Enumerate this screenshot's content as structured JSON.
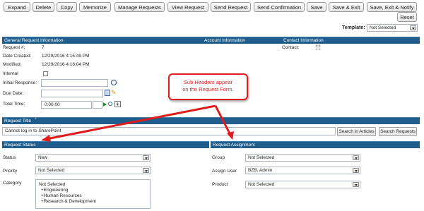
{
  "toolbar": {
    "buttons": [
      "Expand",
      "Delete",
      "Copy",
      "Memorize",
      "Manage Requests",
      "View Request",
      "Send Request",
      "Send Confirmation",
      "Save",
      "Save & Exit",
      "Save, Exit & Notify",
      "Reset"
    ]
  },
  "template": {
    "label": "Template:",
    "value": "Not Selected"
  },
  "general_header": {
    "general": "General Request Information",
    "account": "Account Information",
    "contact": "Contact Information"
  },
  "general": {
    "request_no_label": "Request #:",
    "request_no": "7",
    "date_created_label": "Date Created:",
    "date_created": "12/29/2016 4:15:49 PM",
    "modified_label": "Modified:",
    "modified": "12/29/2016 4:16:04 PM",
    "internal_label": "Internal",
    "initial_response_label": "Initial Response:",
    "due_date_label": "Due Date:",
    "total_time_label": "Total Time:",
    "total_time_value": "0:00:00"
  },
  "contact": {
    "label": "Contact:"
  },
  "callout": {
    "line1": "Sub Headers appear",
    "line2": "on the Request Form."
  },
  "request_title": {
    "header": "Request Title",
    "required_mark": "*",
    "value": "Cannot log in to SharePoint",
    "search_articles": "Search in Articles",
    "search_requests": "Search Requests"
  },
  "status_section": {
    "header": "Request Status",
    "status_label": "Status",
    "status_value": "New",
    "priority_label": "Priority",
    "priority_value": "Not Selected",
    "category_label": "Category",
    "category_items": [
      "Not Selected",
      "+Engineering",
      "+Human Resources",
      "+Research & Development"
    ]
  },
  "assignment_section": {
    "header": "Request Assignment",
    "group_label": "Group",
    "group_value": "Not Selected",
    "assign_user_label": "Assign User",
    "assign_user_value": "BZB, Admin",
    "product_label": "Product",
    "product_value": "Not Selected"
  },
  "colors": {
    "header_bg": "#1f5d8c",
    "callout": "#e01b1b"
  }
}
